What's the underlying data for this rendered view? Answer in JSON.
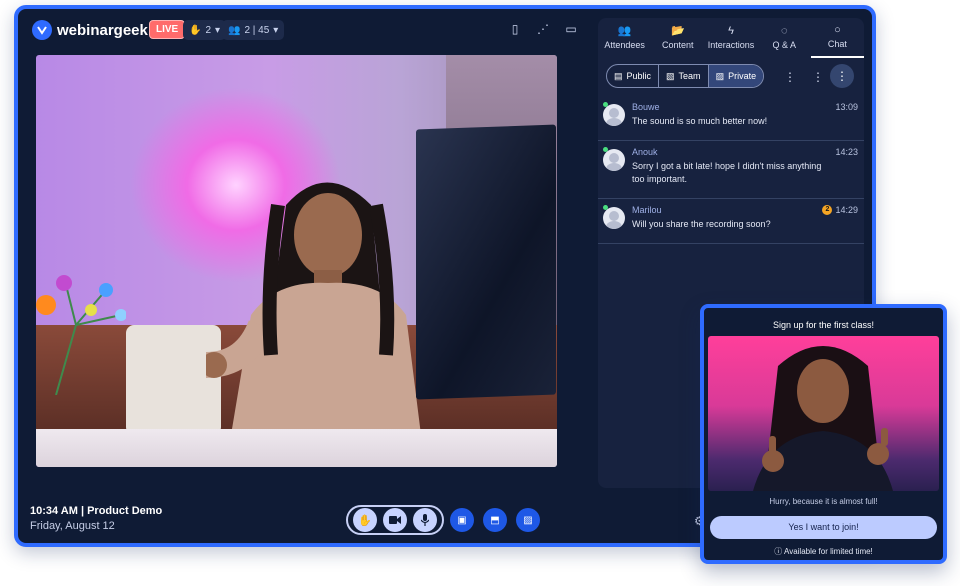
{
  "header": {
    "logo_text": "webinargeek",
    "live_label": "LIVE",
    "hand_count": "2",
    "attendees_count": "2 | 45"
  },
  "stage": {
    "time_label": "10:34 AM | Product Demo",
    "date_label": "Friday, August 12"
  },
  "panel": {
    "tabs": [
      {
        "label": "Attendees",
        "icon": "attendees-icon"
      },
      {
        "label": "Content",
        "icon": "folder-icon"
      },
      {
        "label": "Interactions",
        "icon": "lightning-icon"
      },
      {
        "label": "Q & A",
        "icon": "question-bubble-icon"
      },
      {
        "label": "Chat",
        "icon": "chat-bubble-icon"
      }
    ],
    "active_tab": "Chat",
    "filters": [
      "Public",
      "Team",
      "Private"
    ],
    "active_filter": "Private",
    "messages": [
      {
        "name": "Bouwe",
        "time": "13:09",
        "text": "The sound is so much better now!"
      },
      {
        "name": "Anouk",
        "time": "14:23",
        "text": "Sorry I got a bit late! hope I didn't miss anything too important."
      },
      {
        "name": "Marilou",
        "time": "14:29",
        "badge": "2",
        "text": "Will you share the recording soon?"
      }
    ]
  },
  "promo": {
    "title": "Sign up for the first class!",
    "subtitle": "Hurry, because it is almost full!",
    "button": "Yes I want to join!",
    "note": "Available for limited time!"
  },
  "colors": {
    "accent": "#2f6bff",
    "live": "#ff6b6b",
    "background": "#0f1b35"
  }
}
